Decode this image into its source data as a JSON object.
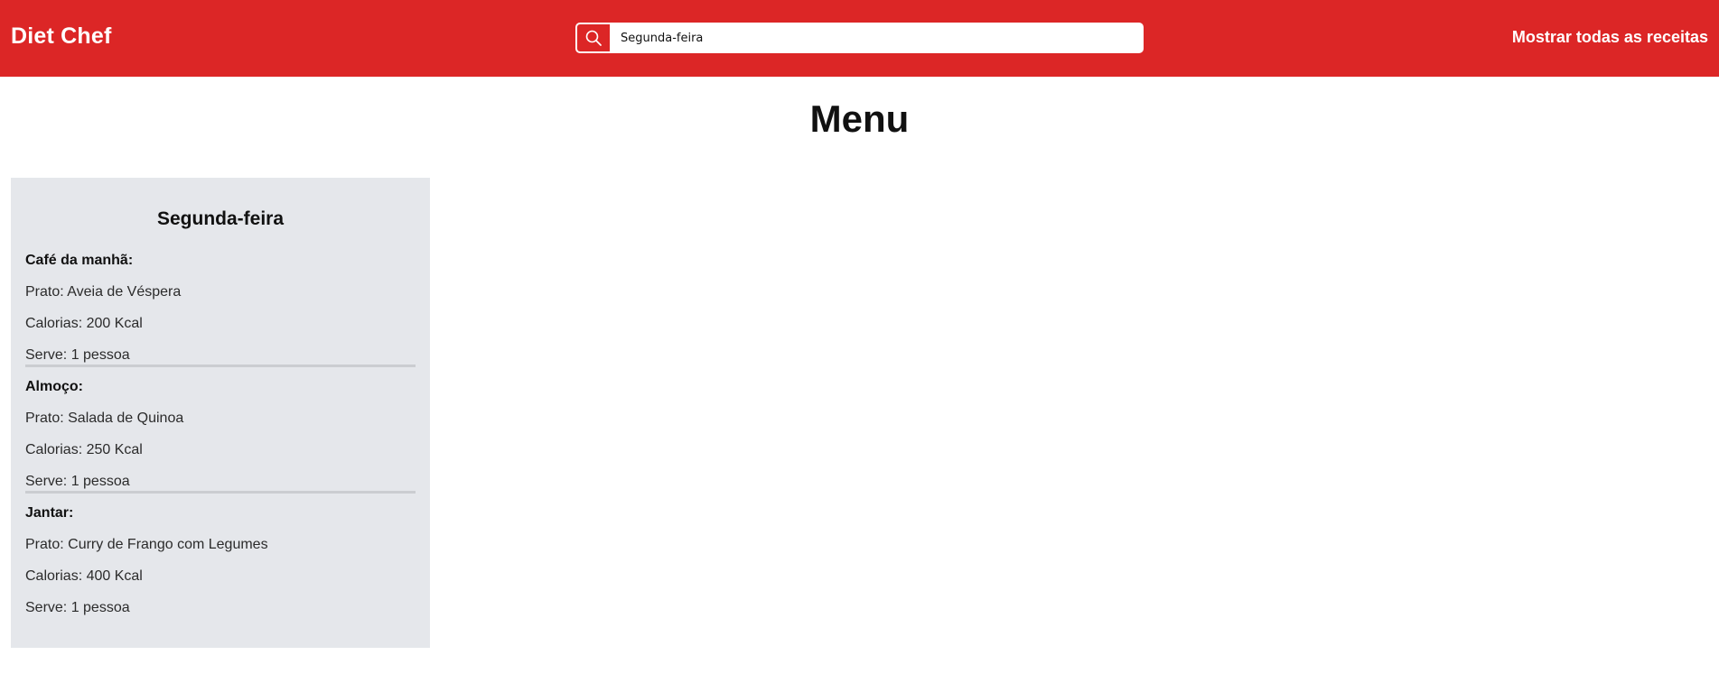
{
  "header": {
    "brand": "Diet Chef",
    "search_value": "Segunda-feira",
    "nav_link": "Mostrar todas as receitas"
  },
  "page": {
    "title": "Menu"
  },
  "day": {
    "title": "Segunda-feira",
    "meals": [
      {
        "label": "Café da manhã:",
        "dish": "Prato: Aveia de Véspera",
        "calories": "Calorias: 200 Kcal",
        "serves": "Serve: 1 pessoa"
      },
      {
        "label": "Almoço:",
        "dish": "Prato: Salada de Quinoa",
        "calories": "Calorias: 250 Kcal",
        "serves": "Serve: 1 pessoa"
      },
      {
        "label": "Jantar:",
        "dish": "Prato: Curry de Frango com Legumes",
        "calories": "Calorias: 400 Kcal",
        "serves": "Serve: 1 pessoa"
      }
    ]
  },
  "colors": {
    "header_bg": "#dc2626",
    "card_bg": "#e5e7eb"
  }
}
